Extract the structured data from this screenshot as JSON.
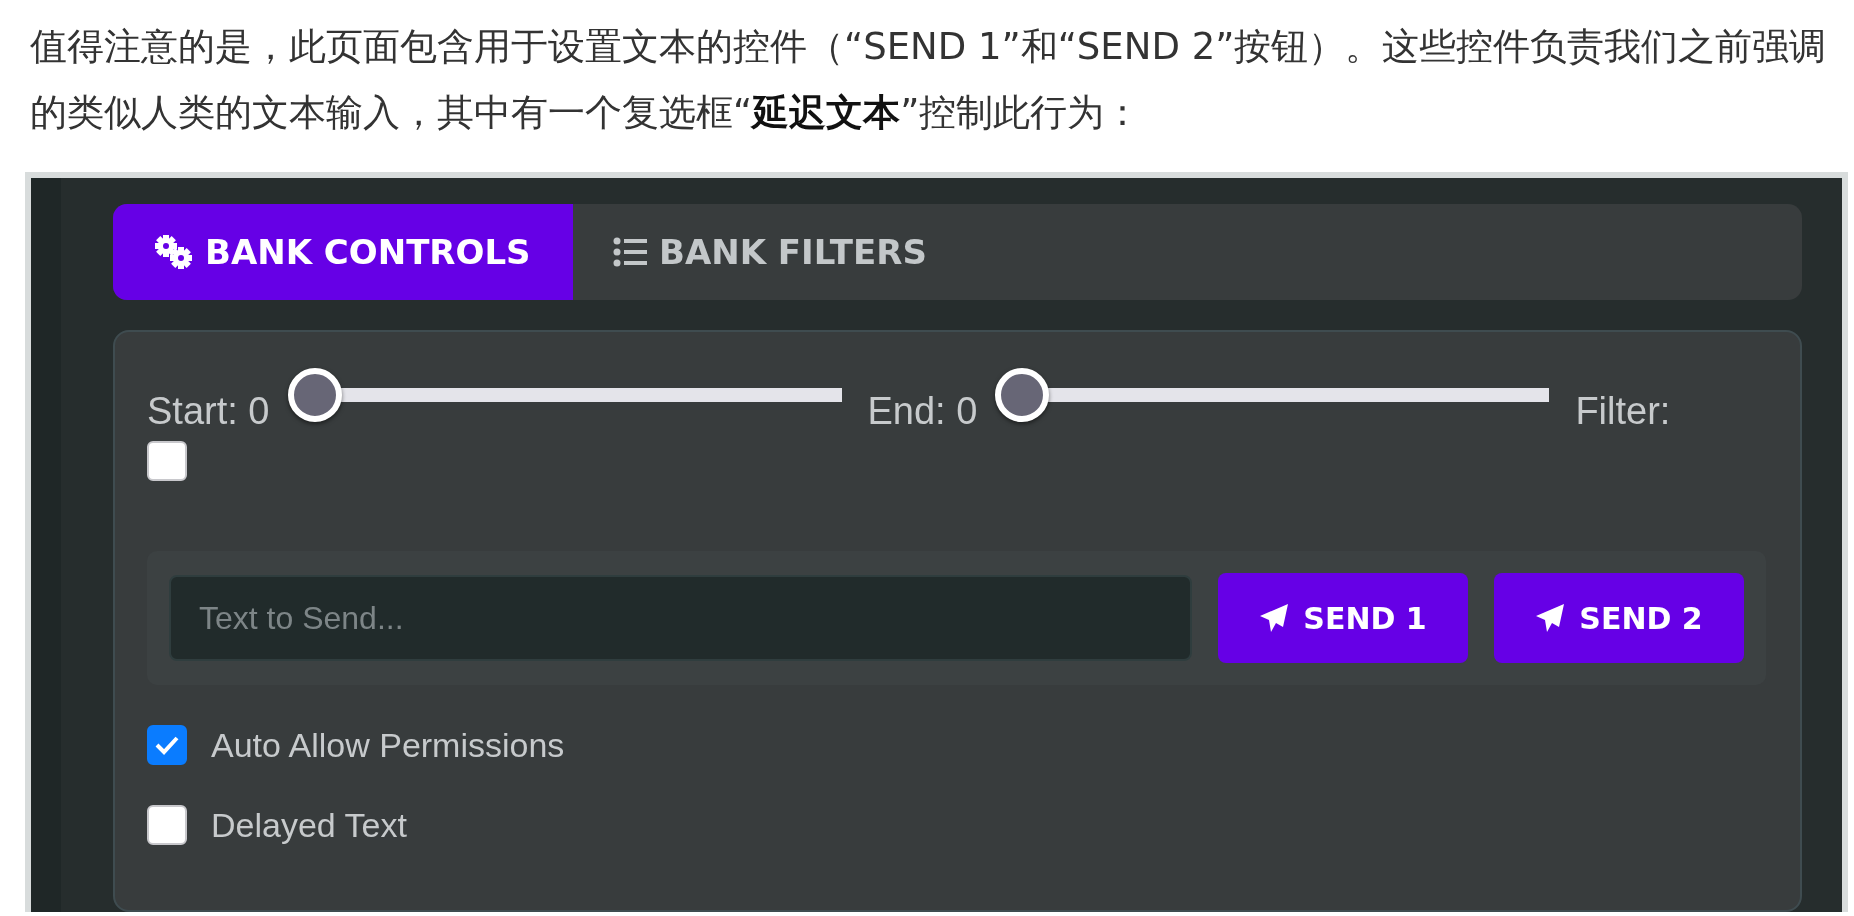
{
  "article": {
    "paragraph": "值得注意的是，此页面包含用于设置文本的控件（“SEND 1”和“SEND 2”按钮）。这些控件负责我们之前强调的类似人类的文本输入，其中有一个复选框“**延迟文本**”控制此行为："
  },
  "tabs": [
    {
      "label": "BANK CONTROLS",
      "selected": true
    },
    {
      "label": "BANK FILTERS",
      "selected": false
    }
  ],
  "sliders": [
    {
      "label": "Start: 0",
      "level": 0
    },
    {
      "label": "End: 0",
      "level": 0
    }
  ],
  "filter": {
    "label": "Filter:",
    "checked": false
  },
  "send": {
    "placeholder": "Text to Send...",
    "buttons": [
      "SEND 1",
      "SEND 2"
    ]
  },
  "options": [
    {
      "label": "Auto Allow Permissions",
      "checked": true
    },
    {
      "label": "Delayed Text",
      "checked": false
    }
  ]
}
